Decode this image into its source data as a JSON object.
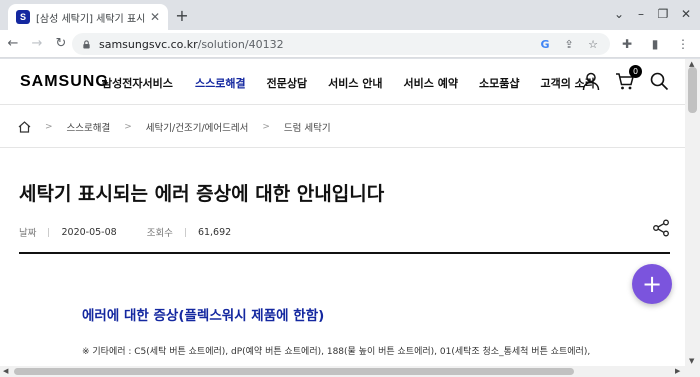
{
  "browser": {
    "tab": {
      "favicon_letter": "S",
      "title": "[삼성 세탁기] 세탁기 표시되는 에러"
    },
    "url": {
      "host": "samsungsvc.co.kr",
      "path": "/solution/40132"
    }
  },
  "header": {
    "logo": "SAMSUNG",
    "service_name": "삼성전자서비스",
    "nav": [
      {
        "label": "스스로해결",
        "active": true
      },
      {
        "label": "전문상담",
        "active": false
      },
      {
        "label": "서비스 안내",
        "active": false
      },
      {
        "label": "서비스 예약",
        "active": false
      },
      {
        "label": "소모품샵",
        "active": false
      },
      {
        "label": "고객의 소리",
        "active": false
      }
    ],
    "cart_count": "0"
  },
  "breadcrumb": [
    "스스로해결",
    "세탁기/건조기/에어드레서",
    "드럼 세탁기"
  ],
  "article": {
    "title": "세탁기 표시되는 에러 증상에 대한 안내입니다",
    "date_label": "날짜",
    "date": "2020-05-08",
    "views_label": "조회수",
    "views": "61,692",
    "section_heading": "에러에 대한 증상(플렉스워시 제품에 한함)",
    "note": "※ 기타에러 : C5(세탁 버튼 쇼트에러), dP(예약 버튼 쇼트에러), 188(물 높이 버튼 쇼트에러), 01(세탁조 청소_통세척 버튼 쇼트에러),"
  },
  "colors": {
    "brand_blue": "#1428a0",
    "fab_purple": "#7b54dd"
  }
}
